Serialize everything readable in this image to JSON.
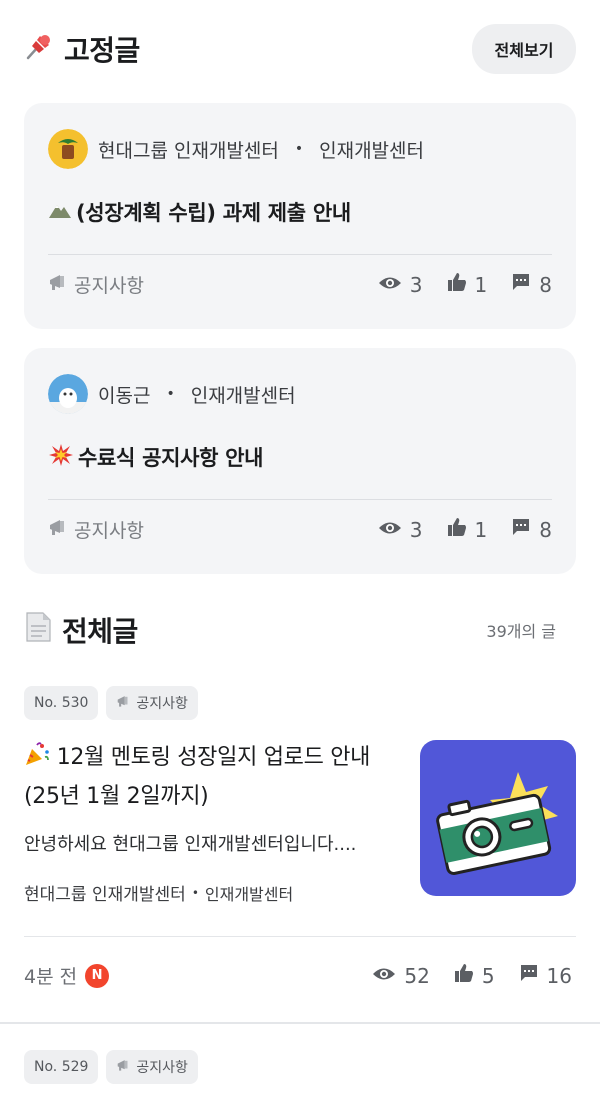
{
  "pinned": {
    "title": "고정글",
    "view_all_label": "전체보기",
    "posts": [
      {
        "author": "현대그룹 인재개발센터",
        "group": "인재개발센터",
        "title": "(성장계획 수립) 과제 제출 안내",
        "category": "공지사항",
        "views": "3",
        "likes": "1",
        "comments": "8"
      },
      {
        "author": "이동근",
        "group": "인재개발센터",
        "title": "수료식 공지사항 안내",
        "category": "공지사항",
        "views": "3",
        "likes": "1",
        "comments": "8"
      }
    ]
  },
  "all_posts": {
    "title": "전체글",
    "count_label": "39개의 글",
    "posts": [
      {
        "number": "No. 530",
        "category": "공지사항",
        "title": "12월 멘토링 성장일지 업로드 안내 (25년 1월 2일까지)",
        "excerpt": "안녕하세요 현대그룹 인재개발센터입니다....",
        "author": "현대그룹 인재개발센터",
        "group": "인재개발센터",
        "time": "4분 전",
        "new_badge": "N",
        "views": "52",
        "likes": "5",
        "comments": "16"
      },
      {
        "number": "No. 529",
        "category": "공지사항"
      }
    ]
  },
  "colors": {
    "card_bg": "#f4f5f7",
    "thumbnail_bg": "#5157d8",
    "new_badge": "#f2452d"
  }
}
